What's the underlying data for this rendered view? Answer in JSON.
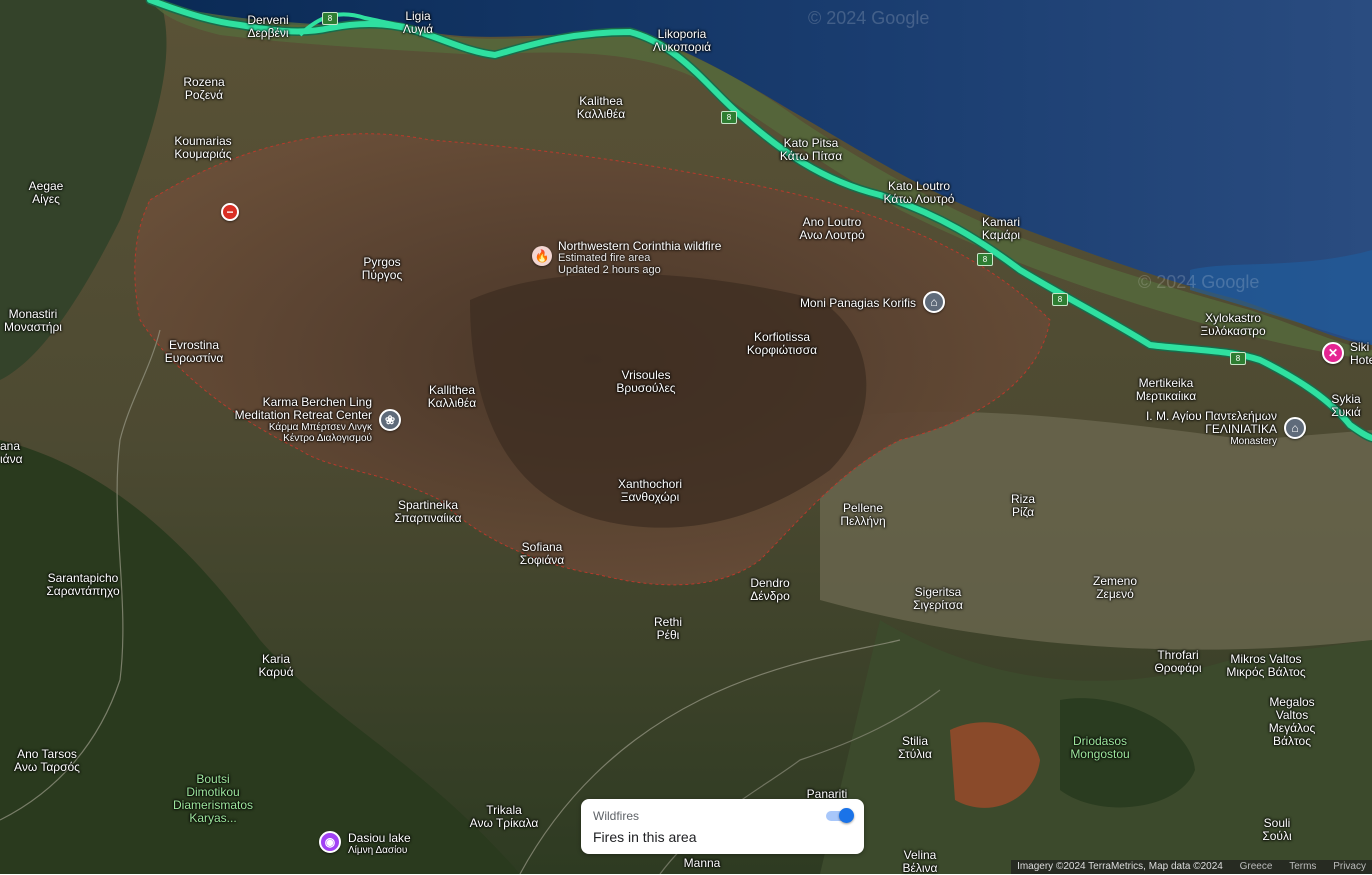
{
  "watermarks": [
    "© 2024 Google",
    "© 2024 Google"
  ],
  "fire": {
    "title": "Northwestern Corinthia wildfire",
    "line1": "Estimated fire area",
    "line2": "Updated 2 hours ago"
  },
  "places": [
    {
      "id": "derveni",
      "en": "Derveni",
      "gr": "Δερβένι"
    },
    {
      "id": "ligia",
      "en": "Ligia",
      "gr": "Λυγιά"
    },
    {
      "id": "likoporia",
      "en": "Likoporia",
      "gr": "Λυκοποριά"
    },
    {
      "id": "rozena",
      "en": "Rozena",
      "gr": "Ροζενά"
    },
    {
      "id": "kalithea-n",
      "en": "Kalithea",
      "gr": "Καλλιθέα"
    },
    {
      "id": "koumarias",
      "en": "Koumarias",
      "gr": "Κουμαριάς"
    },
    {
      "id": "kato-pitsa",
      "en": "Kato Pitsa",
      "gr": "Κάτω Πίτσα"
    },
    {
      "id": "aegae",
      "en": "Aegae",
      "gr": "Αίγες"
    },
    {
      "id": "kato-loutro",
      "en": "Kato Loutro",
      "gr": "Κάτω Λουτρό"
    },
    {
      "id": "ano-loutro",
      "en": "Ano Loutro",
      "gr": "Ανω Λουτρό"
    },
    {
      "id": "kamari",
      "en": "Kamari",
      "gr": "Καμάρι"
    },
    {
      "id": "pyrgos",
      "en": "Pyrgos",
      "gr": "Πύργος"
    },
    {
      "id": "xylokastro",
      "en": "Xylokastro",
      "gr": "Ξυλόκαστρο"
    },
    {
      "id": "monastiri",
      "en": "Monastiri",
      "gr": "Μοναστήρι"
    },
    {
      "id": "korfiotissa",
      "en": "Korfiotissa",
      "gr": "Κορφιώτισσα"
    },
    {
      "id": "evrostina",
      "en": "Evrostina",
      "gr": "Ευρωστίνα"
    },
    {
      "id": "vrisoules",
      "en": "Vrisoules",
      "gr": "Βρυσούλες"
    },
    {
      "id": "mertikeika",
      "en": "Mertikeika",
      "gr": "Μερτικαίικα"
    },
    {
      "id": "kallithea",
      "en": "Kallithea",
      "gr": "Καλλιθέα"
    },
    {
      "id": "sykia",
      "en": "Sykia",
      "gr": "Συκιά"
    },
    {
      "id": "ana",
      "en": "ana",
      "gr": "ιάνα"
    },
    {
      "id": "xanthochori",
      "en": "Xanthochori",
      "gr": "Ξανθοχώρι"
    },
    {
      "id": "pellene",
      "en": "Pellene",
      "gr": "Πελλήνη"
    },
    {
      "id": "riza",
      "en": "Riza",
      "gr": "Ρίζα"
    },
    {
      "id": "spartineika",
      "en": "Spartineika",
      "gr": "Σπαρτιναίικα"
    },
    {
      "id": "sofiana",
      "en": "Sofiana",
      "gr": "Σοφιάνα"
    },
    {
      "id": "sarantapicho",
      "en": "Sarantapicho",
      "gr": "Σαραντάπηχο"
    },
    {
      "id": "dendro",
      "en": "Dendro",
      "gr": "Δένδρο"
    },
    {
      "id": "zemeno",
      "en": "Zemeno",
      "gr": "Ζεμενό"
    },
    {
      "id": "sigeritsa",
      "en": "Sigeritsa",
      "gr": "Σιγερίτσα"
    },
    {
      "id": "rethi",
      "en": "Rethi",
      "gr": "Ρέθι"
    },
    {
      "id": "throfari",
      "en": "Throfari",
      "gr": "Θροφάρι"
    },
    {
      "id": "mikros-valtos",
      "en": "Mikros Valtos",
      "gr": "Μικρός Βάλτος"
    },
    {
      "id": "karia",
      "en": "Karia",
      "gr": "Καρυά"
    },
    {
      "id": "megalos-valtos",
      "en": "Megalos Valtos",
      "gr": "Μεγάλος Βάλτος"
    },
    {
      "id": "stilia",
      "en": "Stilia",
      "gr": "Στύλια"
    },
    {
      "id": "ano-tarsos",
      "en": "Ano Tarsos",
      "gr": "Ανω Ταρσός"
    },
    {
      "id": "trikala",
      "en": "Trikala",
      "gr": "Ανω Τρίκαλα"
    },
    {
      "id": "panariti",
      "en": "Panariti",
      "gr": ""
    },
    {
      "id": "souli",
      "en": "Souli",
      "gr": "Σούλι"
    },
    {
      "id": "velina",
      "en": "Velina",
      "gr": "Βέλινα"
    },
    {
      "id": "manna",
      "en": "Manna",
      "gr": ""
    }
  ],
  "pois": {
    "moni": {
      "en": "Moni Panagias Korifis",
      "icon": "monastery-icon"
    },
    "karma": {
      "en1": "Karma Berchen Ling",
      "en2": "Meditation Retreat Center",
      "gr1": "Κάρμα Μπέρτσεν Λινγκ",
      "gr2": "Κέντρο Διαλογισμού",
      "icon": "meditation-icon"
    },
    "agios": {
      "en": "Ι. Μ. Αγίου Παντελεήμων",
      "gr": "ΓΕΛΙΝΙΑΤΙΚΑ",
      "sub": "Monastery",
      "icon": "monastery-icon"
    },
    "dasiou": {
      "en": "Dasiou lake",
      "gr": "Λίμνη Δασίου",
      "icon": "camera-icon"
    },
    "boutsi": {
      "en1": "Boutsi",
      "en2": "Dimotikou",
      "en3": "Diamerismatos",
      "en4": "Karyas..."
    },
    "driodasos": {
      "en1": "Driodasos",
      "en2": "Mongostou"
    },
    "siki": {
      "en1": "Siki",
      "en2": "Hote",
      "icon": "hotel-icon"
    }
  },
  "route_number": "8",
  "panel": {
    "title": "Wildfires",
    "body": "Fires in this area",
    "toggle_on": true
  },
  "attribution": {
    "text": "Imagery ©2024 TerraMetrics, Map data ©2024",
    "country": "Greece",
    "terms": "Terms",
    "privacy": "Privacy"
  },
  "colors": {
    "sea": "#0d2f5e",
    "highway": "#2fe0a0",
    "fire_border": "#c0392b",
    "panel_toggle": "#1a73e8"
  }
}
